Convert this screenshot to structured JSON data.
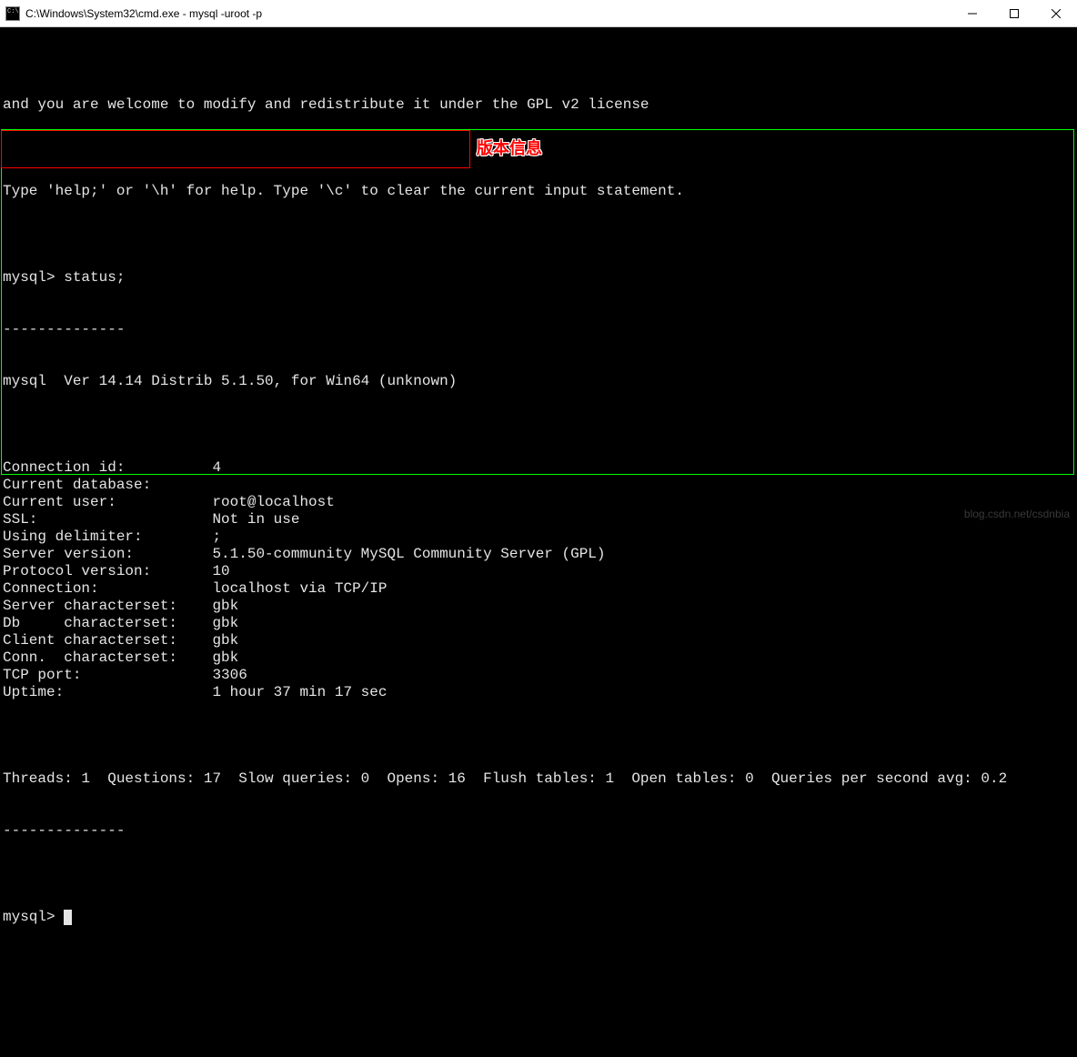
{
  "window": {
    "title": "C:\\Windows\\System32\\cmd.exe - mysql  -uroot -p"
  },
  "intro": {
    "line1": "and you are welcome to modify and redistribute it under the GPL v2 license",
    "blank": "",
    "help": "Type 'help;' or '\\h' for help. Type '\\c' to clear the current input statement.",
    "prompt_status": "mysql> status;",
    "dashes1": "--------------"
  },
  "version_line": "mysql  Ver 14.14 Distrib 5.1.50, for Win64 (unknown)",
  "annotation": "版本信息",
  "status": [
    {
      "k": "Connection id:",
      "v": "4"
    },
    {
      "k": "Current database:",
      "v": ""
    },
    {
      "k": "Current user:",
      "v": "root@localhost"
    },
    {
      "k": "SSL:",
      "v": "Not in use"
    },
    {
      "k": "Using delimiter:",
      "v": ";"
    },
    {
      "k": "Server version:",
      "v": "5.1.50-community MySQL Community Server (GPL)"
    },
    {
      "k": "Protocol version:",
      "v": "10"
    },
    {
      "k": "Connection:",
      "v": "localhost via TCP/IP"
    },
    {
      "k": "Server characterset:",
      "v": "gbk"
    },
    {
      "k": "Db     characterset:",
      "v": "gbk"
    },
    {
      "k": "Client characterset:",
      "v": "gbk"
    },
    {
      "k": "Conn.  characterset:",
      "v": "gbk"
    },
    {
      "k": "TCP port:",
      "v": "3306"
    },
    {
      "k": "Uptime:",
      "v": "1 hour 37 min 17 sec"
    }
  ],
  "stats_line": "Threads: 1  Questions: 17  Slow queries: 0  Opens: 16  Flush tables: 1  Open tables: 0  Queries per second avg: 0.2",
  "dashes2": "--------------",
  "prompt2": "mysql>",
  "watermark": "blog.csdn.net/csdnbia"
}
